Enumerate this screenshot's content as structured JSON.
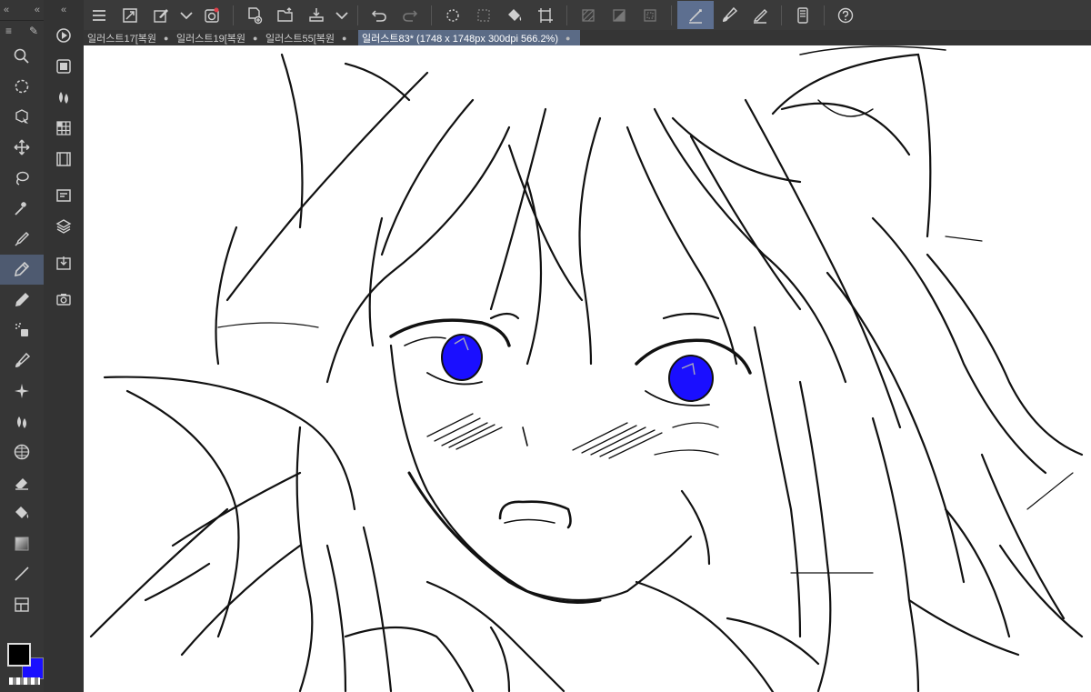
{
  "tabs": [
    {
      "label": "일러스트17[복원"
    },
    {
      "label": "일러스트19[복원"
    },
    {
      "label": "일러스트55[복원"
    },
    {
      "label": "일러스트83* (1748 x 1748px 300dpi 566.2%)",
      "active": true
    }
  ],
  "colors": {
    "main": "#000000",
    "sub": "#1a0fff",
    "eye": "#1a0fff"
  },
  "toolbar_icons": [
    "menu-icon",
    "new-canvas-icon",
    "pen-settings-icon",
    "chevron-down-icon",
    "stabilizer-icon",
    "new-file-icon",
    "open-file-icon",
    "save-icon",
    "chevron-down-icon",
    "undo-icon",
    "redo-icon",
    "loading-icon",
    "transform-icon",
    "fill-icon",
    "crop-icon",
    "hatch-icon",
    "tone-icon",
    "border-icon",
    "pen-active-icon",
    "brush-icon",
    "pencil-icon",
    "device-icon",
    "help-icon"
  ],
  "tools": [
    "zoom-icon",
    "rotate-icon",
    "object-select-icon",
    "move-icon",
    "lasso-icon",
    "magic-wand-icon",
    "eyedropper-icon",
    "pen-icon",
    "pencil-icon",
    "airbrush-icon",
    "brush-icon",
    "decoration-icon",
    "blend-icon",
    "figure-icon",
    "eraser-icon",
    "fill-icon",
    "gradient-icon",
    "line-icon",
    "frame-icon"
  ]
}
